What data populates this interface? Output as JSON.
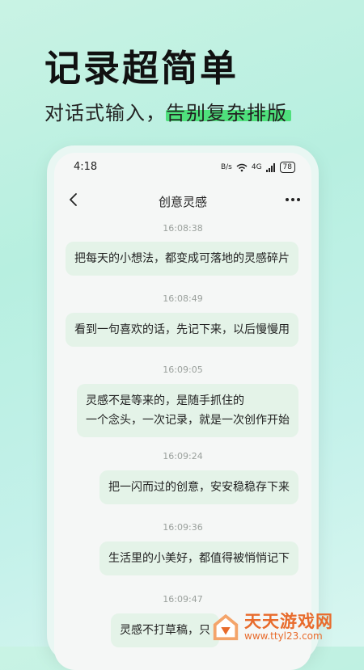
{
  "promo": {
    "headline": "记录超简单",
    "subheadline": "对话式输入，告别复杂排版"
  },
  "status_bar": {
    "time": "4:18",
    "network": "B/s",
    "signal": "4G",
    "battery": "78"
  },
  "nav": {
    "title": "创意灵感"
  },
  "messages": [
    {
      "time": "16:08:38",
      "text": "把每天的小想法，都变成可落地的灵感碎片"
    },
    {
      "time": "16:08:49",
      "text": "看到一句喜欢的话，先记下来，以后慢慢用"
    },
    {
      "time": "16:09:05",
      "line1": "灵感不是等来的，是随手抓住的",
      "line2": "一个念头，一次记录，就是一次创作开始"
    },
    {
      "time": "16:09:24",
      "text": "把一闪而过的创意，安安稳稳存下来"
    },
    {
      "time": "16:09:36",
      "text": "生活里的小美好，都值得被悄悄记下"
    },
    {
      "time": "16:09:47",
      "text": "灵感不打草稿，只"
    }
  ],
  "watermark": {
    "name": "天天游戏网",
    "url": "www.ttyl23.com"
  },
  "colors": {
    "highlight": "#4fe07c",
    "bubble": "#e4f3e8",
    "watermark": "#e86b2c"
  }
}
